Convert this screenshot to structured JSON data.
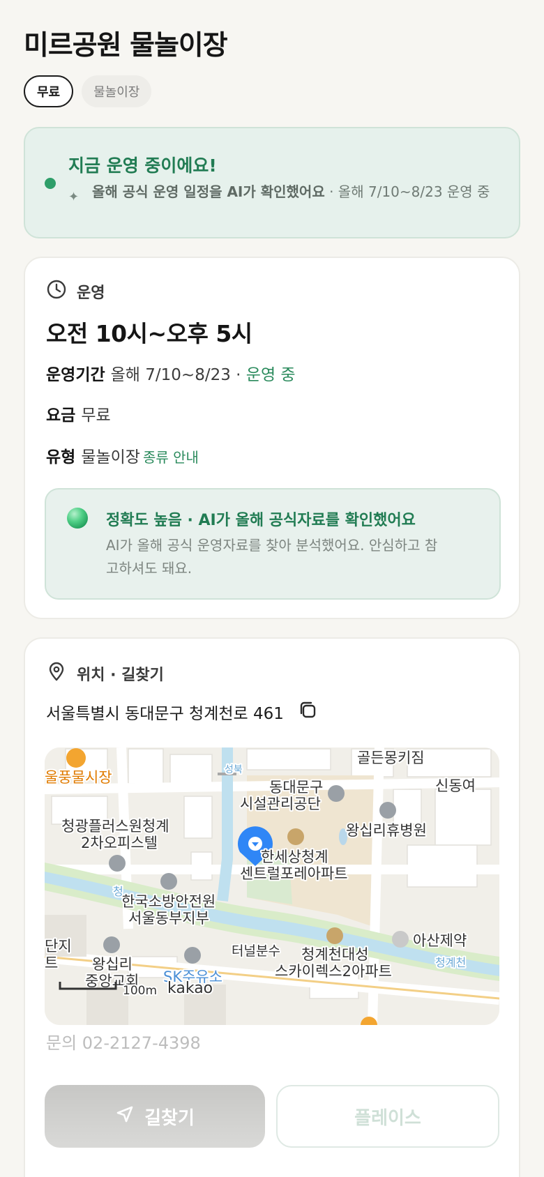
{
  "place": {
    "title": "미르공원 물놀이장",
    "tags": [
      "무료",
      "물놀이장"
    ]
  },
  "status_banner": {
    "title": "지금 운영 중이에요!",
    "desc_bold": "올해 공식 운영 일정을 AI가 확인했어요",
    "desc_rest": " · 올해 7/10~8/23 운영 중",
    "colors": {
      "accent": "#217c53",
      "background": "#e6f1ec",
      "dot": "#2e9e69"
    }
  },
  "operation": {
    "heading": "운영",
    "hours": "오전 10시~오후 5시",
    "period_label": "운영기간",
    "period_value": "올해 7/10~8/23 ·",
    "period_status": "운영 중",
    "fee_label": "요금",
    "fee_value": "무료",
    "type_label": "유형",
    "type_value": "물놀이장",
    "type_link": "종류 안내",
    "accuracy_title": "정확도 높음 · AI가 올해 공식자료를 확인했어요",
    "accuracy_desc": "AI가 올해 공식 운영자료를 찾아 분석했어요. 안심하고 참고하셔도 돼요."
  },
  "location": {
    "heading": "위치 · 길찾기",
    "address": "서울특별시 동대문구 청계천로 461",
    "map_labels": {
      "market": "울풍물시장",
      "golden": "골든몽키짐",
      "facility1": "동대문구",
      "facility2": "시설관리공단",
      "sindong": "신동여",
      "officetel1": "청광플러스원청계",
      "officetel2": "2차오피스텔",
      "hospital": "왕십리휴병원",
      "apt1": "한세상청계",
      "apt2": "센트럴포레아파트",
      "fire1": "한국소방안전원",
      "fire2": "서울동부지부",
      "danji1": "단지",
      "danji2": "트",
      "church1": "왕십리",
      "church2": "중앙교회",
      "fountain": "터널분수",
      "sky1": "청계천대성",
      "sky2": "스카이렉스2아파트",
      "asan": "아산제약",
      "gas": "SK주유소",
      "scale": "100m",
      "brand": "kakao",
      "stream": "청계천",
      "stream_left": "청",
      "sungbuk": "성북"
    },
    "contact": "문의 02-2127-4398",
    "directions_button": "길찾기",
    "place_button": "플레이스"
  }
}
